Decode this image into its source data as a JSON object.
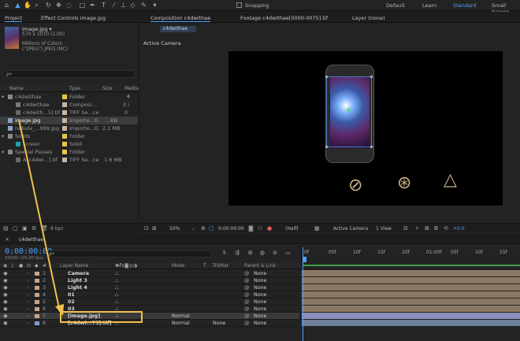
{
  "toolbar": {
    "snapping_label": "Snapping",
    "workspaces": [
      "Default",
      "Learn",
      "Standard",
      "Small Screen"
    ],
    "active_workspace": "Standard"
  },
  "project_panel": {
    "tab_project": "Project",
    "tab_effect_controls": "Effect Controls image.jpg",
    "preview": {
      "name": "image.jpg ▾",
      "dims": "570 x 1010 (1.00)",
      "colors": "Millions of Colors",
      "format": "(\"ZPEG\") JPEG (MC)"
    },
    "search_placeholder": "ρ•",
    "headers": {
      "name": "Name",
      "type": "Type",
      "size": "Size",
      "media": "Media"
    },
    "items": [
      {
        "name": "c4dwithae",
        "type": "Folder",
        "size": "",
        "indent": 0,
        "color": "#e6c84a"
      },
      {
        "name": "c4dwithae",
        "type": "Composi...",
        "size": "0 i",
        "indent": 1,
        "color": "#c7b6a3"
      },
      {
        "name": "c4dwith...5].tif",
        "type": "TIFF Se...ce",
        "size": "0",
        "indent": 1,
        "color": "#c7b6a3"
      },
      {
        "name": "image.jpg",
        "type": "Importe...G",
        "size": "...KB",
        "indent": 0,
        "color": "#c7b6a3"
      },
      {
        "name": "nebula_...999.jpg",
        "type": "Importe...G",
        "size": "2.1 MB",
        "indent": 0,
        "color": "#c7b6a3"
      },
      {
        "name": "Solids",
        "type": "Folder",
        "size": "",
        "indent": 0,
        "color": "#e6c84a"
      },
      {
        "name": "screen",
        "type": "Solid",
        "size": "",
        "indent": 1,
        "color": "#e6c84a"
      },
      {
        "name": "Special Passes",
        "type": "Folder",
        "size": "",
        "indent": 0,
        "color": "#e6c84a"
      },
      {
        "name": "A_c4dwi...].tif",
        "type": "TIFF Se...ce",
        "size": "1.6 MB",
        "indent": 1,
        "color": "#c7b6a3"
      }
    ],
    "bpc": "8 bpc"
  },
  "comp_panel": {
    "tab_composition": "Composition c4dwithae",
    "tab_footage": "Footage c4dwithae[0000-0075].tif",
    "tab_layer": "Layer (none)",
    "comp_chip": "c4dwithae",
    "active_camera_label": "Active Camera",
    "bottom_bar": {
      "zoom": "50%",
      "timecode": "0:00:00:00",
      "resolution": "(Half)",
      "camera": "Active Camera",
      "views": "1 View",
      "exposure": "+0.0"
    }
  },
  "timeline": {
    "tab": "c4dwithae",
    "timecode": "0:00:00:00",
    "fps": "00000 (25.00 fps)",
    "search_placeholder": "ρ•",
    "headers": {
      "layer_name": "Layer Name",
      "mode": "Mode",
      "t": "T",
      "trkmat": "TrkMat",
      "parent": "Parent & Link"
    },
    "ruler": [
      "0f",
      "05f",
      "10f",
      "15f",
      "20f",
      "01:00f",
      "05f",
      "10f",
      "15f",
      "20f"
    ],
    "layers": [
      {
        "num": "1",
        "name": "Camera",
        "mode": "",
        "trkmat": "",
        "parent": "None",
        "color": "#c7a58a"
      },
      {
        "num": "2",
        "name": "Light 3",
        "mode": "",
        "trkmat": "",
        "parent": "None",
        "color": "#c7a58a"
      },
      {
        "num": "3",
        "name": "Light 4",
        "mode": "",
        "trkmat": "",
        "parent": "None",
        "color": "#c7a58a"
      },
      {
        "num": "4",
        "name": "01",
        "mode": "",
        "trkmat": "",
        "parent": "None",
        "color": "#c7a58a"
      },
      {
        "num": "5",
        "name": "02",
        "mode": "",
        "trkmat": "",
        "parent": "None",
        "color": "#c7a58a"
      },
      {
        "num": "6",
        "name": "03",
        "mode": "",
        "trkmat": "",
        "parent": "None",
        "color": "#c7a58a"
      },
      {
        "num": "7",
        "name": "[image.jpg]",
        "mode": "Normal",
        "trkmat": "",
        "parent": "None",
        "color": "#c7a58a"
      },
      {
        "num": "8",
        "name": "[c4dwi...75].tif]",
        "mode": "Normal",
        "trkmat": "None",
        "parent": "None",
        "color": "#7e9fc7"
      }
    ]
  },
  "colors": {
    "accent": "#4aa3ff",
    "highlight_box": "#f2c04d",
    "folder": "#e6c84a",
    "layer_bar": "#8c7866",
    "selected_bar": "#8d8fbf"
  }
}
